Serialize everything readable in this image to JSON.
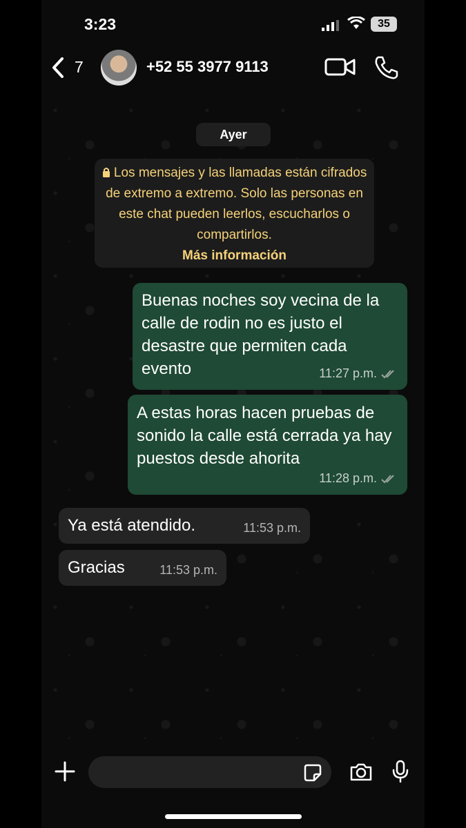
{
  "status_bar": {
    "time": "3:23",
    "battery": "35"
  },
  "header": {
    "back_count": "7",
    "contact": "+52 55 3977 9113"
  },
  "chat": {
    "day_label": "Ayer",
    "encryption_notice": "Los mensajes y las llamadas están cifrados de extremo a extremo. Solo las personas en este chat pueden leerlos, escucharlos o compartirlos.",
    "encryption_link": "Más información",
    "messages": [
      {
        "direction": "outgoing",
        "text": "Buenas noches soy vecina de la calle de rodin no es justo el desastre que permiten cada evento",
        "time": "11:27 p.m."
      },
      {
        "direction": "outgoing",
        "text": "A estas horas hacen pruebas de sonido la calle está cerrada ya hay puestos desde ahorita",
        "time": "11:28 p.m."
      },
      {
        "direction": "incoming",
        "text": "Ya está atendido.",
        "time": "11:53 p.m."
      },
      {
        "direction": "incoming",
        "text": "Gracias",
        "time": "11:53 p.m."
      }
    ]
  },
  "colors": {
    "outgoing_bubble": "#1f4a35",
    "incoming_bubble": "#242424",
    "system_text": "#f5d27a",
    "background": "#0b0b0b"
  }
}
